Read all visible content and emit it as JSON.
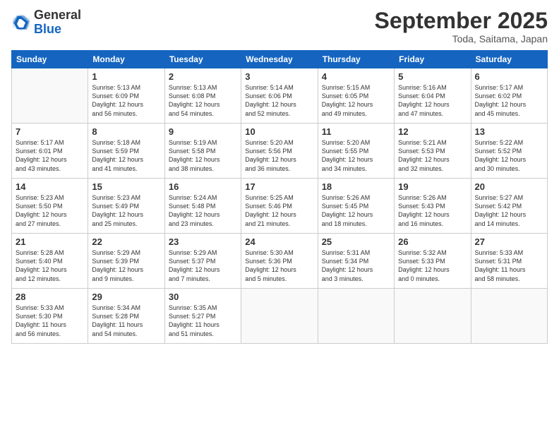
{
  "header": {
    "logo_general": "General",
    "logo_blue": "Blue",
    "month_title": "September 2025",
    "subtitle": "Toda, Saitama, Japan"
  },
  "days_of_week": [
    "Sunday",
    "Monday",
    "Tuesday",
    "Wednesday",
    "Thursday",
    "Friday",
    "Saturday"
  ],
  "weeks": [
    [
      {
        "day": "",
        "content": ""
      },
      {
        "day": "1",
        "content": "Sunrise: 5:13 AM\nSunset: 6:09 PM\nDaylight: 12 hours\nand 56 minutes."
      },
      {
        "day": "2",
        "content": "Sunrise: 5:13 AM\nSunset: 6:08 PM\nDaylight: 12 hours\nand 54 minutes."
      },
      {
        "day": "3",
        "content": "Sunrise: 5:14 AM\nSunset: 6:06 PM\nDaylight: 12 hours\nand 52 minutes."
      },
      {
        "day": "4",
        "content": "Sunrise: 5:15 AM\nSunset: 6:05 PM\nDaylight: 12 hours\nand 49 minutes."
      },
      {
        "day": "5",
        "content": "Sunrise: 5:16 AM\nSunset: 6:04 PM\nDaylight: 12 hours\nand 47 minutes."
      },
      {
        "day": "6",
        "content": "Sunrise: 5:17 AM\nSunset: 6:02 PM\nDaylight: 12 hours\nand 45 minutes."
      }
    ],
    [
      {
        "day": "7",
        "content": "Sunrise: 5:17 AM\nSunset: 6:01 PM\nDaylight: 12 hours\nand 43 minutes."
      },
      {
        "day": "8",
        "content": "Sunrise: 5:18 AM\nSunset: 5:59 PM\nDaylight: 12 hours\nand 41 minutes."
      },
      {
        "day": "9",
        "content": "Sunrise: 5:19 AM\nSunset: 5:58 PM\nDaylight: 12 hours\nand 38 minutes."
      },
      {
        "day": "10",
        "content": "Sunrise: 5:20 AM\nSunset: 5:56 PM\nDaylight: 12 hours\nand 36 minutes."
      },
      {
        "day": "11",
        "content": "Sunrise: 5:20 AM\nSunset: 5:55 PM\nDaylight: 12 hours\nand 34 minutes."
      },
      {
        "day": "12",
        "content": "Sunrise: 5:21 AM\nSunset: 5:53 PM\nDaylight: 12 hours\nand 32 minutes."
      },
      {
        "day": "13",
        "content": "Sunrise: 5:22 AM\nSunset: 5:52 PM\nDaylight: 12 hours\nand 30 minutes."
      }
    ],
    [
      {
        "day": "14",
        "content": "Sunrise: 5:23 AM\nSunset: 5:50 PM\nDaylight: 12 hours\nand 27 minutes."
      },
      {
        "day": "15",
        "content": "Sunrise: 5:23 AM\nSunset: 5:49 PM\nDaylight: 12 hours\nand 25 minutes."
      },
      {
        "day": "16",
        "content": "Sunrise: 5:24 AM\nSunset: 5:48 PM\nDaylight: 12 hours\nand 23 minutes."
      },
      {
        "day": "17",
        "content": "Sunrise: 5:25 AM\nSunset: 5:46 PM\nDaylight: 12 hours\nand 21 minutes."
      },
      {
        "day": "18",
        "content": "Sunrise: 5:26 AM\nSunset: 5:45 PM\nDaylight: 12 hours\nand 18 minutes."
      },
      {
        "day": "19",
        "content": "Sunrise: 5:26 AM\nSunset: 5:43 PM\nDaylight: 12 hours\nand 16 minutes."
      },
      {
        "day": "20",
        "content": "Sunrise: 5:27 AM\nSunset: 5:42 PM\nDaylight: 12 hours\nand 14 minutes."
      }
    ],
    [
      {
        "day": "21",
        "content": "Sunrise: 5:28 AM\nSunset: 5:40 PM\nDaylight: 12 hours\nand 12 minutes."
      },
      {
        "day": "22",
        "content": "Sunrise: 5:29 AM\nSunset: 5:39 PM\nDaylight: 12 hours\nand 9 minutes."
      },
      {
        "day": "23",
        "content": "Sunrise: 5:29 AM\nSunset: 5:37 PM\nDaylight: 12 hours\nand 7 minutes."
      },
      {
        "day": "24",
        "content": "Sunrise: 5:30 AM\nSunset: 5:36 PM\nDaylight: 12 hours\nand 5 minutes."
      },
      {
        "day": "25",
        "content": "Sunrise: 5:31 AM\nSunset: 5:34 PM\nDaylight: 12 hours\nand 3 minutes."
      },
      {
        "day": "26",
        "content": "Sunrise: 5:32 AM\nSunset: 5:33 PM\nDaylight: 12 hours\nand 0 minutes."
      },
      {
        "day": "27",
        "content": "Sunrise: 5:33 AM\nSunset: 5:31 PM\nDaylight: 11 hours\nand 58 minutes."
      }
    ],
    [
      {
        "day": "28",
        "content": "Sunrise: 5:33 AM\nSunset: 5:30 PM\nDaylight: 11 hours\nand 56 minutes."
      },
      {
        "day": "29",
        "content": "Sunrise: 5:34 AM\nSunset: 5:28 PM\nDaylight: 11 hours\nand 54 minutes."
      },
      {
        "day": "30",
        "content": "Sunrise: 5:35 AM\nSunset: 5:27 PM\nDaylight: 11 hours\nand 51 minutes."
      },
      {
        "day": "",
        "content": ""
      },
      {
        "day": "",
        "content": ""
      },
      {
        "day": "",
        "content": ""
      },
      {
        "day": "",
        "content": ""
      }
    ]
  ]
}
